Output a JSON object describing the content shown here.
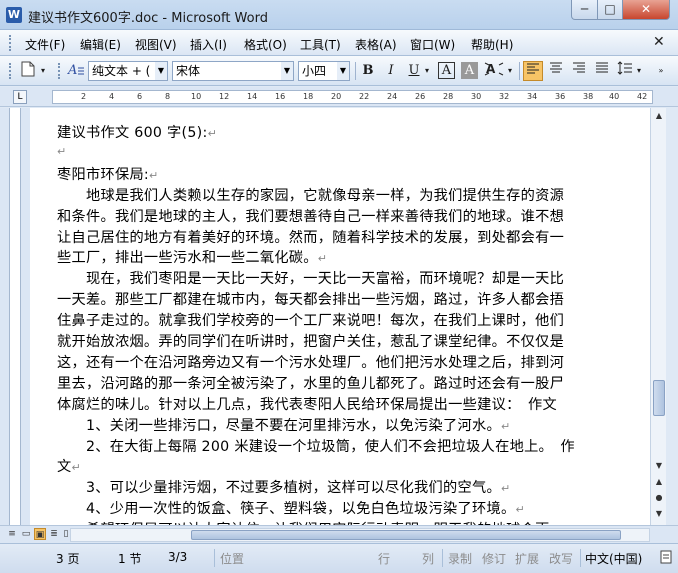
{
  "window": {
    "app_icon": "W",
    "title": "建议书作文600字.doc - Microsoft Word",
    "min_glyph": "─",
    "max_glyph": "□",
    "close_glyph": "✕"
  },
  "menu": {
    "items": [
      "文件(F)",
      "编辑(E)",
      "视图(V)",
      "插入(I)",
      "格式(O)",
      "工具(T)",
      "表格(A)",
      "窗口(W)",
      "帮助(H)"
    ],
    "close_glyph": "✕"
  },
  "toolbar": {
    "style_value": "纯文本 + (",
    "font_value": "宋体",
    "size_value": "小四",
    "bold": "B",
    "italic": "I",
    "underline": "U",
    "char_border": "A",
    "char_shading": "A"
  },
  "ruler": {
    "corner": "L",
    "ticks": [
      "2",
      "4",
      "6",
      "8",
      "10",
      "12",
      "14",
      "16",
      "18",
      "20",
      "22",
      "24",
      "26",
      "28",
      "30",
      "32",
      "34",
      "36",
      "38",
      "40",
      "42"
    ]
  },
  "document": {
    "lines": [
      "建议书作文 600 字(5):",
      "",
      "枣阳市环保局:",
      "　　地球是我们人类赖以生存的家园，它就像母亲一样，为我们提供生存的资源",
      "和条件。我们是地球的主人，我们要想善待自己一样来善待我们的地球。谁不想",
      "让自己居住的地方有着美好的环境。然而，随着科学技术的发展，到处都会有一",
      "些工厂，排出一些污水和一些二氧化碳。",
      "　　现在，我们枣阳是一天比一天好，一天比一天富裕，而环境呢？却是一天比",
      "一天差。那些工厂都建在城市内，每天都会排出一些污烟，路过，许多人都会捂",
      "住鼻子走过的。就拿我们学校旁的一个工厂来说吧！每次，在我们上课时，他们",
      "就开始放浓烟。弄的同学们在听讲时，把窗户关住，惹乱了课堂纪律。不仅仅是",
      "这，还有一个在沿河路旁边又有一个污水处理厂。他们把污水处理之后，排到河",
      "里去，沿河路的那一条河全被污染了，水里的鱼儿都死了。路过时还会有一股尸",
      "体腐烂的味儿。针对以上几点，我代表枣阳人民给环保局提出一些建议：　作文",
      "　　1、关闭一些排污口，尽量不要在河里排污水，以免污染了河水。",
      "　　2、在大街上每隔 200 米建设一个垃圾筒，使人们不会把垃圾人在地上。　作",
      "文",
      "　　3、可以少量排污烟，不过要多植树，这样可以尽化我们的空气。",
      "　　4、少用一次性的饭盒、筷子、塑料袋，以免白色垃圾污染了环境。",
      "　　希望环保局可以认大家认住，让我们用实际行动表明，明天我的地球会更"
    ],
    "marks": [
      true,
      true,
      true,
      false,
      false,
      false,
      true,
      false,
      false,
      false,
      false,
      false,
      false,
      false,
      true,
      false,
      true,
      true,
      true,
      false
    ]
  },
  "status": {
    "page": "3 页",
    "section": "1 节",
    "page_of": "3/3",
    "position": "位置",
    "line": "行",
    "column": "列",
    "rec": "录制",
    "trk": "修订",
    "ext": "扩展",
    "ovr": "改写",
    "language": "中文(中国)"
  },
  "colors": {
    "title_bar": "#c9dcf1",
    "close_button": "#c8462e",
    "active_button": "#f7c466"
  }
}
